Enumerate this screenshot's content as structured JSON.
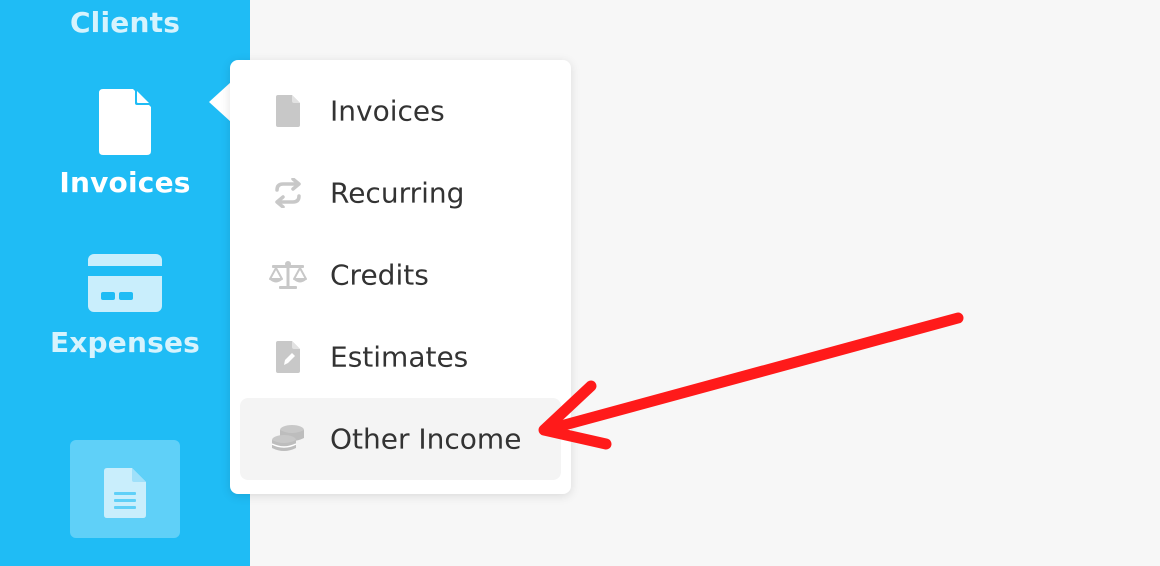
{
  "sidebar": {
    "items": [
      {
        "label": "Clients"
      },
      {
        "label": "Invoices",
        "icon": "document-icon",
        "active": true
      },
      {
        "label": "Expenses",
        "icon": "credit-card-icon"
      }
    ],
    "tile_icon": "document-lines-icon"
  },
  "dropdown": {
    "items": [
      {
        "label": "Invoices",
        "icon": "file-icon"
      },
      {
        "label": "Recurring",
        "icon": "recurring-arrows-icon"
      },
      {
        "label": "Credits",
        "icon": "scale-balance-icon"
      },
      {
        "label": "Estimates",
        "icon": "file-pen-icon"
      },
      {
        "label": "Other Income",
        "icon": "coins-stack-icon",
        "highlighted": true
      }
    ]
  },
  "colors": {
    "sidebar": "#1fbcf5",
    "sidebar_muted_text": "#d6f3fd",
    "menu_text": "#333333",
    "menu_icon": "#c8c8c8",
    "highlight": "#f4f4f4",
    "annotation_arrow": "#ff1a1a"
  }
}
